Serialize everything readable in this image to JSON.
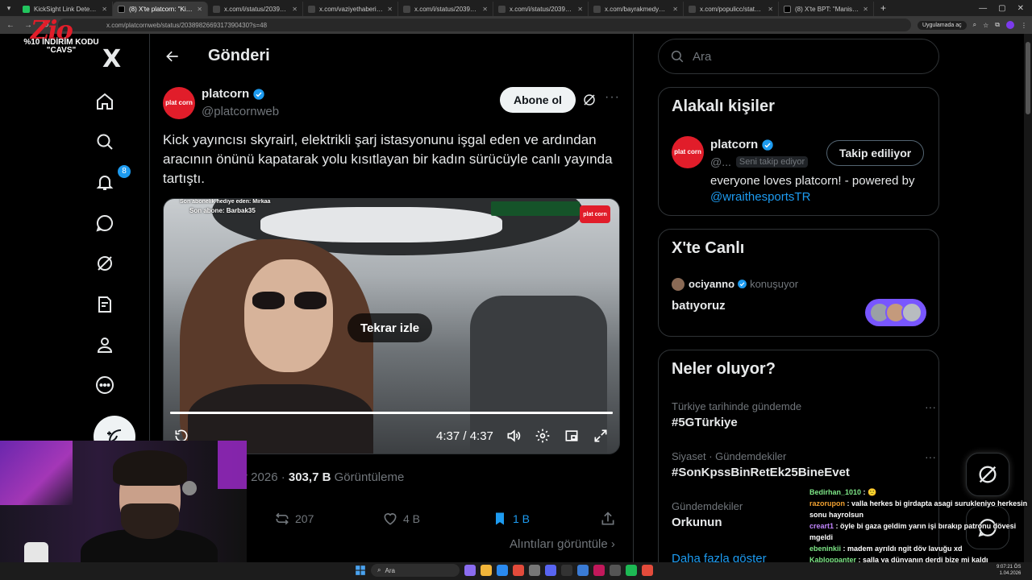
{
  "browser": {
    "tabs": [
      {
        "label": "KickSight Link Detector",
        "color": "#22c55e",
        "active": false
      },
      {
        "label": "(8) X'te platcorn: \"Kick yayıncısı",
        "color": "#000000",
        "active": true
      },
      {
        "label": "x.com/i/status/203921517108",
        "color": "#444444",
        "active": false
      },
      {
        "label": "x.com/vaziyethaberi/status/20",
        "color": "#444444",
        "active": false
      },
      {
        "label": "x.com/i/status/20393730221",
        "color": "#444444",
        "active": false
      },
      {
        "label": "x.com/i/status/20393734733",
        "color": "#444444",
        "active": false
      },
      {
        "label": "x.com/bayrakmedya/status/20",
        "color": "#444444",
        "active": false
      },
      {
        "label": "x.com/populicc/status/19418",
        "color": "#444444",
        "active": false
      },
      {
        "label": "(8) X'te BPT: \"Manisa'da 2 ayd",
        "color": "#000000",
        "active": false
      }
    ],
    "url": "x.com/platcornweb/status/2038982669317390430?s=48",
    "app_button": "Uygulamada aç"
  },
  "overlay": {
    "logo": "Zio",
    "promo_line1": "%10 İNDİRİM KODU",
    "promo_line2": "\"CAVS\""
  },
  "nav": {
    "notification_count": "8"
  },
  "header": {
    "title": "Gönderi"
  },
  "post": {
    "author_name": "platcorn",
    "author_handle": "@platcornweb",
    "avatar_text": "plat corn",
    "subscribe_label": "Abone ol",
    "text": "Kick yayıncısı skyrairl, elektrikli şarj istasyonunu işgal eden ve ardından aracının önünü kapatarak yolu kısıtlayan bir kadın sürücüyle canlı yayında tartıştı.",
    "video": {
      "overlay_line1": "Son abonelik hediye eden: Mirkaa",
      "overlay_line2": "Son abone: Barbak35",
      "logo_text": "plat corn",
      "replay_label": "Tekrar izle",
      "time": "4:37 / 4:37",
      "progress": 1.0
    },
    "meta_date_partial": "r 2026 · ",
    "views_count": "303,7 B",
    "views_label": "Görüntüleme",
    "reposts": "207",
    "likes": "4 B",
    "bookmarks": "1 B",
    "quotes_link": "Alıntıları görüntüle ›"
  },
  "sidebar": {
    "search_placeholder": "Ara",
    "related": {
      "title": "Alakalı kişiler",
      "name": "platcorn",
      "handle": "@...",
      "follows_you": "Seni takip ediyor",
      "following_label": "Takip ediliyor",
      "bio_text": "everyone loves platcorn! - powered by ",
      "bio_mention": "@wraithesportsTR"
    },
    "live": {
      "title": "X'te Canlı",
      "host": "ociyanno",
      "host_status": "konuşuyor",
      "space_title": "batıyoruz"
    },
    "trends": {
      "title": "Neler oluyor?",
      "items": [
        {
          "context": "Türkiye tarihinde gündemde",
          "name": "#5GTürkiye"
        },
        {
          "context": "Siyaset · Gündemdekiler",
          "name": "#SonKpssBinRetEk25BineEvet"
        },
        {
          "context": "Gündemdekiler",
          "name": "Orkunun"
        }
      ],
      "show_more": "Daha fazla göster"
    }
  },
  "chat": [
    {
      "user": "Bedirhan_1010",
      "color": "#7ee787",
      "text": " : 🙁"
    },
    {
      "user": "razorupon",
      "color": "#f0a030",
      "text": " : valla herkes bi girdapta asagi surukleniyo herkesin sonu hayrolsun"
    },
    {
      "user": "creart1",
      "color": "#c084fc",
      "text": " : öyle bi gaza geldim yarın işi bırakıp patronu dövesi mgeldi"
    },
    {
      "user": "ebeninkii",
      "color": "#7ee787",
      "text": " : madem ayrıldı ngit döv lavuğu xd"
    },
    {
      "user": "Kabloppanter",
      "color": "#7ee787",
      "text": " : salla ya dünyanın derdi bize mi kaldı"
    }
  ],
  "taskbar": {
    "search_label": "Ara",
    "time": "9:07:21 ÖS",
    "date": "1.04.2026"
  },
  "colors": {
    "accent": "#1d9bf0",
    "brand_red": "#e11d2a",
    "live_purple": "#7856ff"
  }
}
